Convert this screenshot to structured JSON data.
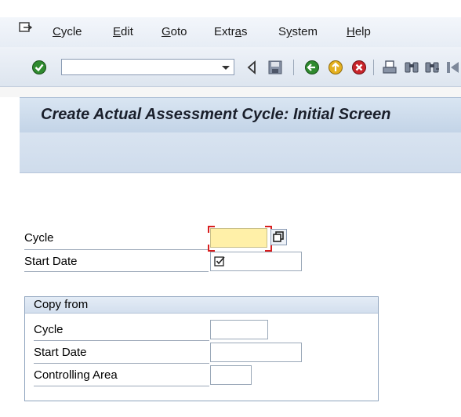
{
  "menu": {
    "items": [
      {
        "label": "Cycle",
        "u": "C",
        "rest": "ycle"
      },
      {
        "label": "Edit",
        "u": "E",
        "rest": "dit"
      },
      {
        "label": "Goto",
        "u": "G",
        "rest": "oto"
      },
      {
        "label": "Extras",
        "pre": "Extr",
        "u": "a",
        "rest": "s"
      },
      {
        "label": "System",
        "pre": "S",
        "u": "y",
        "rest": "stem"
      },
      {
        "label": "Help",
        "u": "H",
        "rest": "elp"
      }
    ]
  },
  "toolbar": {
    "command_field_value": "",
    "icons": [
      "enter-icon",
      "back-triangle-icon",
      "save-icon",
      "back-icon",
      "exit-icon",
      "cancel-icon",
      "print-icon",
      "find-icon",
      "find-next-icon"
    ]
  },
  "title": "Create Actual Assessment Cycle: Initial Screen",
  "form": {
    "cycle_label": "Cycle",
    "cycle_value": "",
    "start_date_label": "Start Date",
    "start_date_value": ""
  },
  "copy_from": {
    "header": "Copy from",
    "cycle_label": "Cycle",
    "cycle_value": "",
    "start_date_label": "Start Date",
    "start_date_value": "",
    "controlling_area_label": "Controlling Area",
    "controlling_area_value": ""
  },
  "colors": {
    "required_field": "#fff0a8",
    "focus_marker": "#d81e1e",
    "title_bar": "#c3d4e7"
  }
}
